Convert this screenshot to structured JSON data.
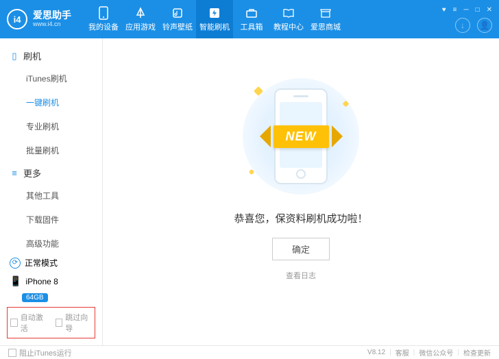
{
  "brand": {
    "logo_text": "i4",
    "title": "爱思助手",
    "url": "www.i4.cn"
  },
  "nav": [
    {
      "label": "我的设备",
      "icon": "device"
    },
    {
      "label": "应用游戏",
      "icon": "apps"
    },
    {
      "label": "铃声壁纸",
      "icon": "music"
    },
    {
      "label": "智能刷机",
      "icon": "flash",
      "active": true
    },
    {
      "label": "工具箱",
      "icon": "toolbox"
    },
    {
      "label": "教程中心",
      "icon": "book"
    },
    {
      "label": "爱思商城",
      "icon": "store"
    }
  ],
  "sidebar": {
    "cat1": {
      "label": "刷机"
    },
    "cat1_items": [
      "iTunes刷机",
      "一键刷机",
      "专业刷机",
      "批量刷机"
    ],
    "cat1_active_index": 1,
    "cat2": {
      "label": "更多"
    },
    "cat2_items": [
      "其他工具",
      "下载固件",
      "高级功能"
    ],
    "mode": "正常模式",
    "device_name": "iPhone 8",
    "device_capacity": "64GB",
    "auto_activate": "自动激活",
    "skip_wizard": "跳过向导"
  },
  "main": {
    "ribbon": "NEW",
    "success": "恭喜您，保资料刷机成功啦！",
    "ok": "确定",
    "view_log": "查看日志"
  },
  "footer": {
    "block_itunes": "阻止iTunes运行",
    "version": "V8.12",
    "support": "客服",
    "wechat": "微信公众号",
    "update": "检查更新"
  }
}
